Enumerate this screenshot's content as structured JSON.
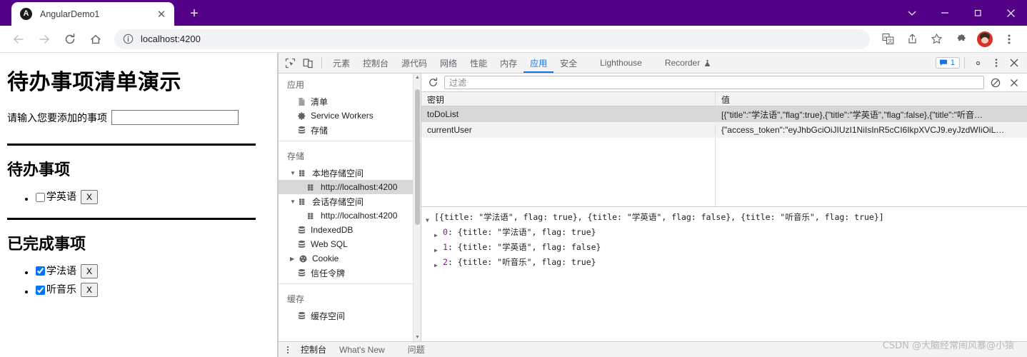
{
  "colors": {
    "titlebar_purple": "#510087",
    "accent_blue": "#1a73e8",
    "selected_row": "#d8d8d8",
    "checkbox_blue": "#1a73e8"
  },
  "browser": {
    "tab": {
      "title": "AngularDemo1",
      "favicon_letter": "A",
      "close_glyph": "✕"
    },
    "new_tab_glyph": "+",
    "window_controls": [
      {
        "name": "tab-search",
        "glyph": "⌄"
      },
      {
        "name": "minimize",
        "glyph": "—"
      },
      {
        "name": "maximize",
        "glyph": "❐"
      },
      {
        "name": "close",
        "glyph": "✕"
      }
    ],
    "omnibox": {
      "url": "localhost:4200",
      "info_glyph": "ⓘ"
    },
    "nav": {
      "back": "←",
      "forward": "→",
      "reload": "↻",
      "home": "⌂"
    },
    "toolbar_icons": [
      "translate-icon",
      "share-icon",
      "bookmark-star-icon",
      "extensions-puzzle-icon",
      "profile-avatar",
      "chrome-menu-kebab"
    ]
  },
  "page": {
    "title": "待办事项清单演示",
    "input_label": "请输入您要添加的事项",
    "input_value": "",
    "input_placeholder": "",
    "todo_heading": "待办事项",
    "done_heading": "已完成事项",
    "delete_label": "X",
    "todo_items": [
      {
        "title": "学英语",
        "flag": false
      }
    ],
    "done_items": [
      {
        "title": "学法语",
        "flag": true
      },
      {
        "title": "听音乐",
        "flag": true
      }
    ]
  },
  "devtools": {
    "tabs": [
      {
        "label": "元素",
        "active": false
      },
      {
        "label": "控制台",
        "active": false
      },
      {
        "label": "源代码",
        "active": false
      },
      {
        "label": "网络",
        "active": false
      },
      {
        "label": "性能",
        "active": false
      },
      {
        "label": "内存",
        "active": false
      },
      {
        "label": "应用",
        "active": true
      },
      {
        "label": "安全",
        "active": false
      },
      {
        "label": "Lighthouse",
        "active": false
      },
      {
        "label": "Recorder",
        "active": false
      }
    ],
    "message_badge_count": "1",
    "left_icons": [
      "inspect-element-icon",
      "device-toolbar-icon"
    ],
    "right_icons": [
      "messages-badge",
      "settings-gear-icon",
      "more-options-kebab-icon",
      "close-devtools-icon"
    ],
    "sidebar": {
      "groups": [
        {
          "title": "应用",
          "items": [
            {
              "label": "清单",
              "icon": "manifest-doc-icon",
              "indent": 1
            },
            {
              "label": "Service Workers",
              "icon": "gear-icon",
              "indent": 1
            },
            {
              "label": "存储",
              "icon": "database-icon",
              "indent": 1
            }
          ]
        },
        {
          "title": "存储",
          "items": [
            {
              "label": "本地存储空间",
              "icon": "table-grid-icon",
              "indent": 1,
              "arrow": "▼"
            },
            {
              "label": "http://localhost:4200",
              "icon": "table-grid-icon",
              "indent": 2,
              "selected": true
            },
            {
              "label": "会话存储空间",
              "icon": "table-grid-icon",
              "indent": 1,
              "arrow": "▼"
            },
            {
              "label": "http://localhost:4200",
              "icon": "table-grid-icon",
              "indent": 2
            },
            {
              "label": "IndexedDB",
              "icon": "database-icon",
              "indent": 1
            },
            {
              "label": "Web SQL",
              "icon": "database-icon",
              "indent": 1
            },
            {
              "label": "Cookie",
              "icon": "cookie-icon",
              "indent": 1,
              "arrow": "▶"
            },
            {
              "label": "信任令牌",
              "icon": "database-icon",
              "indent": 1
            }
          ]
        },
        {
          "title": "缓存",
          "items": [
            {
              "label": "缓存空间",
              "icon": "database-icon",
              "indent": 1
            }
          ]
        }
      ]
    },
    "storage": {
      "toolbar": {
        "refresh_icon": "refresh-icon",
        "filter_placeholder": "过滤",
        "filter_value": "",
        "clear_all_icon": "clear-all-icon",
        "delete_selected_icon": "delete-selected-icon"
      },
      "columns": [
        "密钥",
        "值"
      ],
      "rows": [
        {
          "key": "toDoList",
          "value": "[{\"title\":\"学法语\",\"flag\":true},{\"title\":\"学英语\",\"flag\":false},{\"title\":\"听音…",
          "selected": true
        },
        {
          "key": "currentUser",
          "value": "{\"access_token\":\"eyJhbGciOiJIUzI1NiIsInR5cCI6IkpXVCJ9.eyJzdWIiOiL…",
          "selected": false
        }
      ]
    },
    "preview": {
      "root": "[{title: \"学法语\", flag: true}, {title: \"学英语\", flag: false}, {title: \"听音乐\", flag: true}]",
      "entries": [
        {
          "index": "0",
          "text": "{title: \"学法语\", flag: true}"
        },
        {
          "index": "1",
          "text": "{title: \"学英语\", flag: false}"
        },
        {
          "index": "2",
          "text": "{title: \"听音乐\", flag: true}"
        }
      ]
    },
    "drawer": {
      "tabs": [
        "控制台",
        "What's New",
        "问题"
      ]
    }
  },
  "watermark": "CSDN @大脑经常闹风暴@小猿"
}
